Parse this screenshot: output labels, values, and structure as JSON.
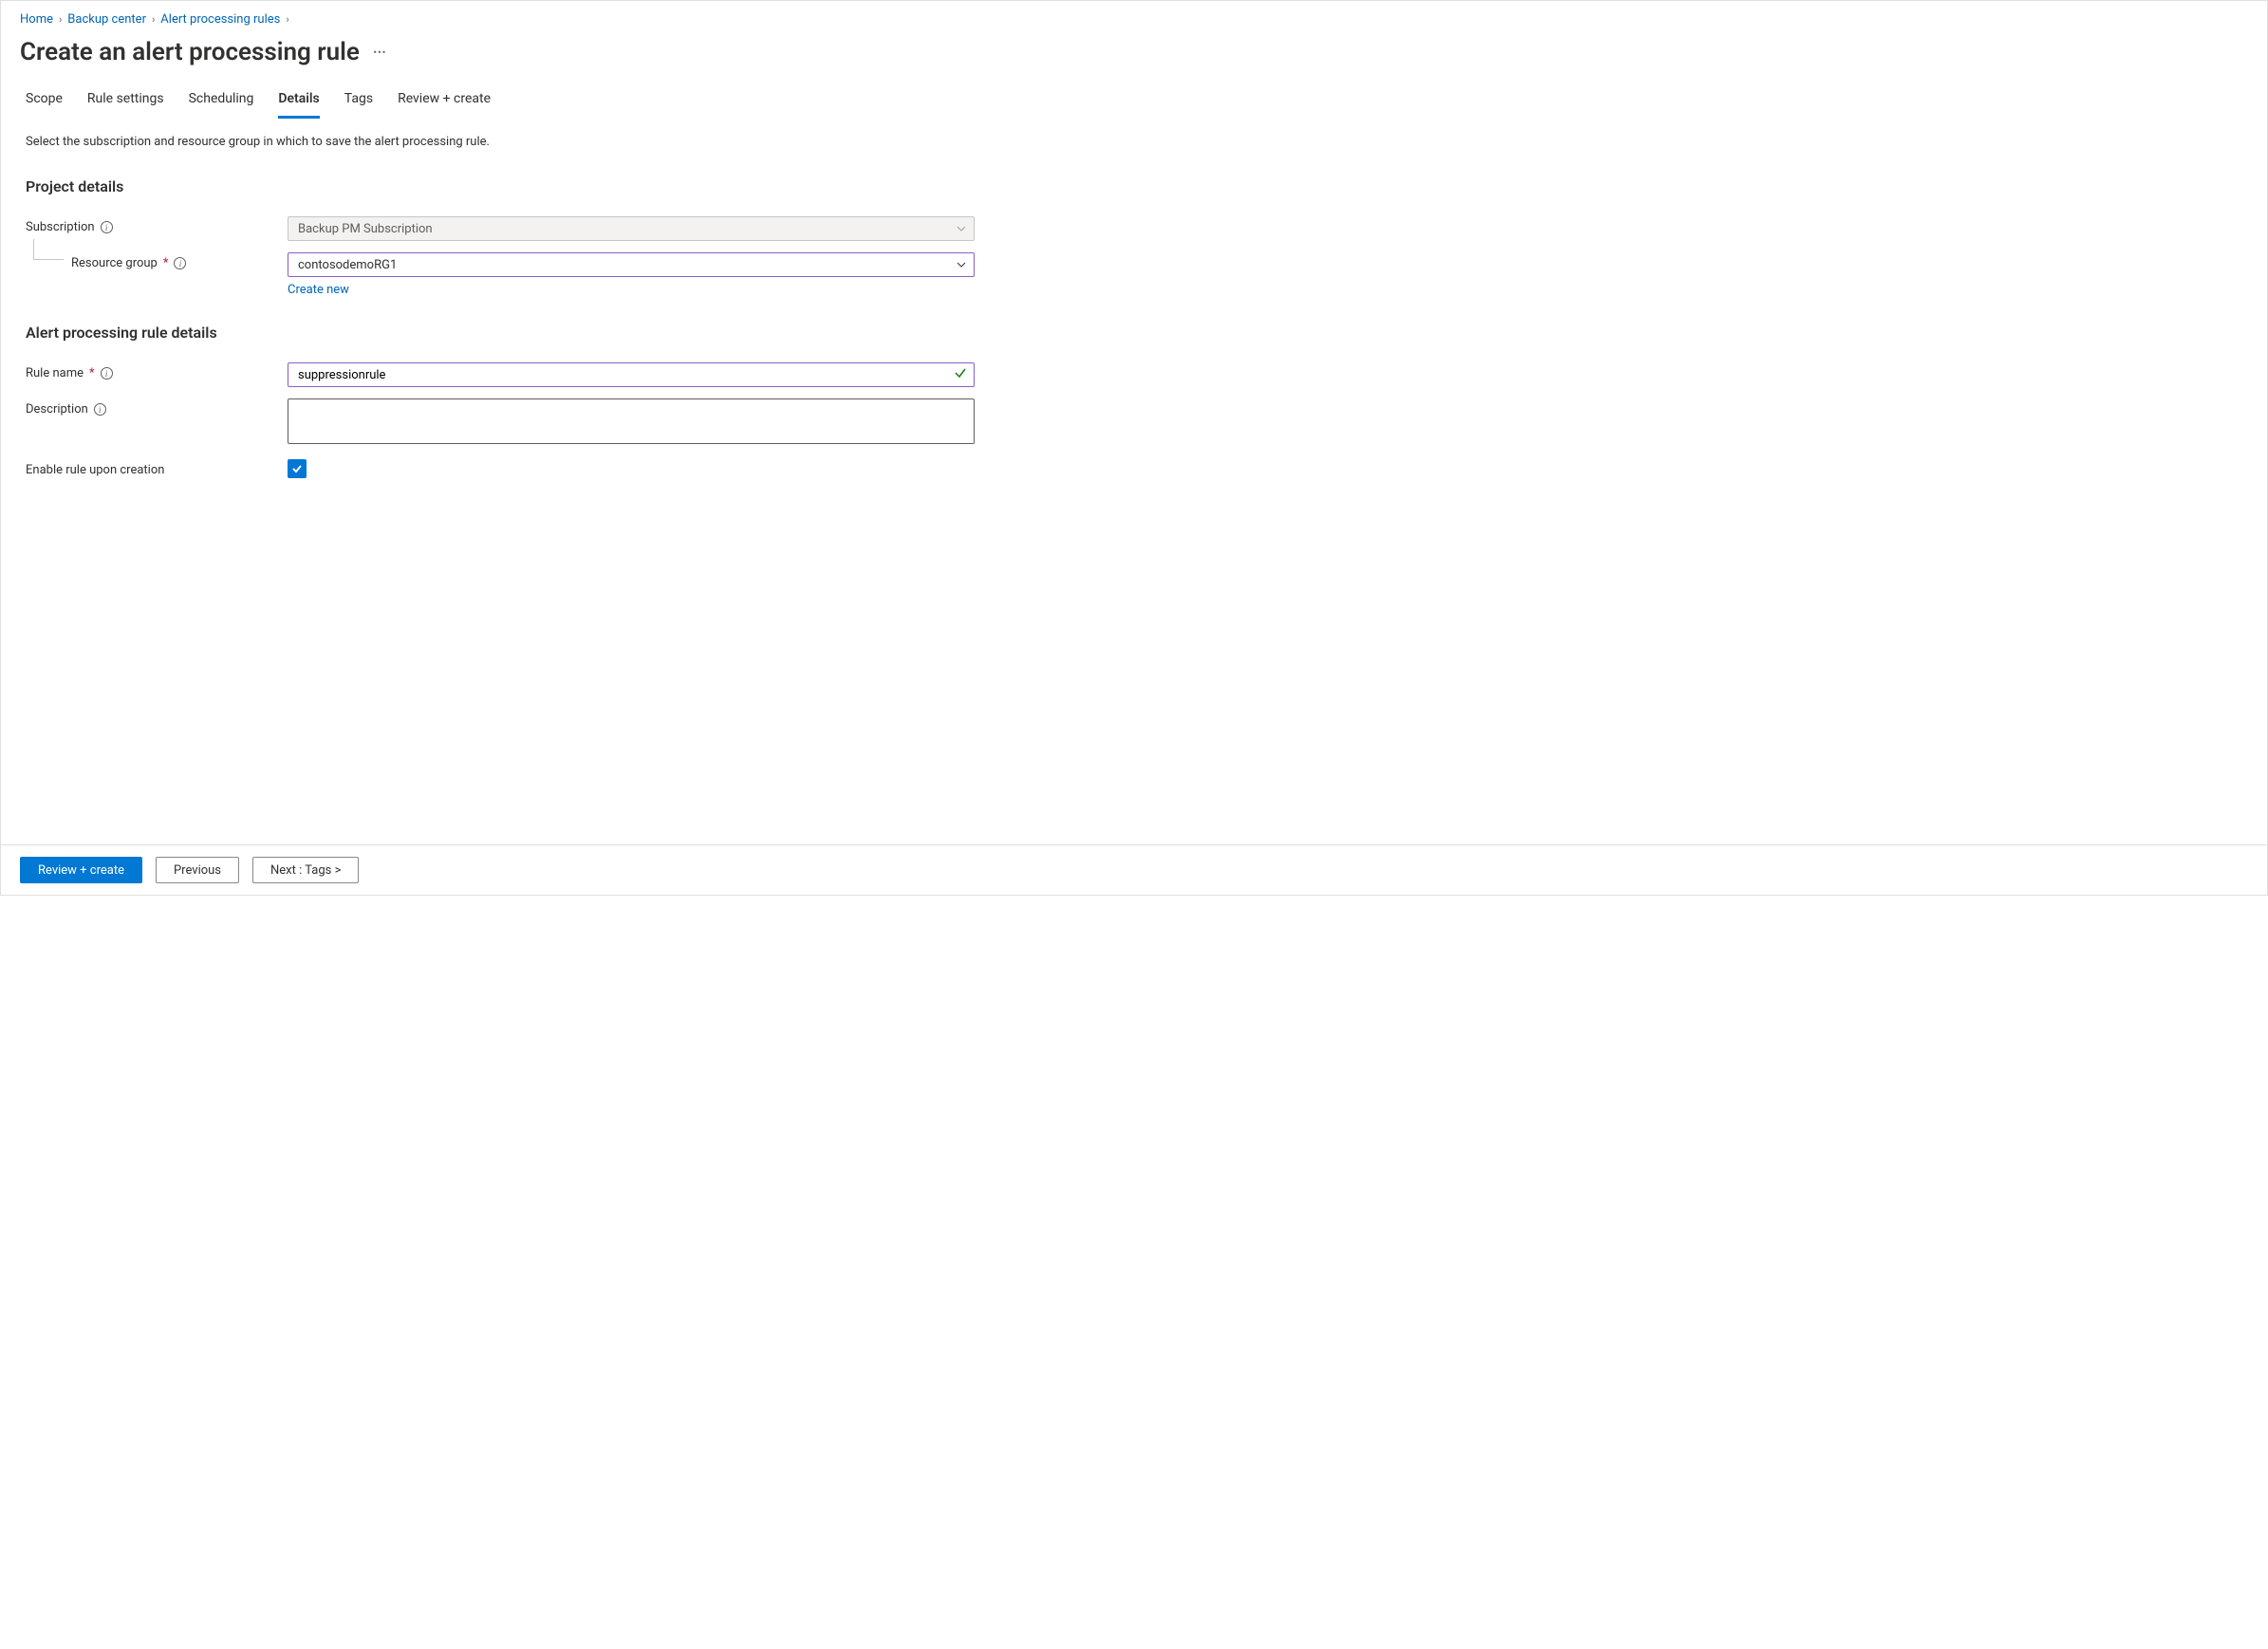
{
  "breadcrumb": {
    "items": [
      {
        "label": "Home"
      },
      {
        "label": "Backup center"
      },
      {
        "label": "Alert processing rules"
      }
    ]
  },
  "page": {
    "title": "Create an alert processing rule"
  },
  "tabs": {
    "items": [
      {
        "label": "Scope",
        "active": false
      },
      {
        "label": "Rule settings",
        "active": false
      },
      {
        "label": "Scheduling",
        "active": false
      },
      {
        "label": "Details",
        "active": true
      },
      {
        "label": "Tags",
        "active": false
      },
      {
        "label": "Review + create",
        "active": false
      }
    ]
  },
  "hint": "Select the subscription and resource group in which to save the alert processing rule.",
  "sections": {
    "project": {
      "title": "Project details",
      "subscription_label": "Subscription",
      "subscription_value": "Backup PM Subscription",
      "resource_group_label": "Resource group",
      "resource_group_value": "contosodemoRG1",
      "create_new": "Create new"
    },
    "rule": {
      "title": "Alert processing rule details",
      "rule_name_label": "Rule name",
      "rule_name_value": "suppressionrule",
      "description_label": "Description",
      "description_value": "",
      "enable_label": "Enable rule upon creation",
      "enable_checked": true
    }
  },
  "footer": {
    "review": "Review + create",
    "previous": "Previous",
    "next": "Next : Tags >"
  }
}
